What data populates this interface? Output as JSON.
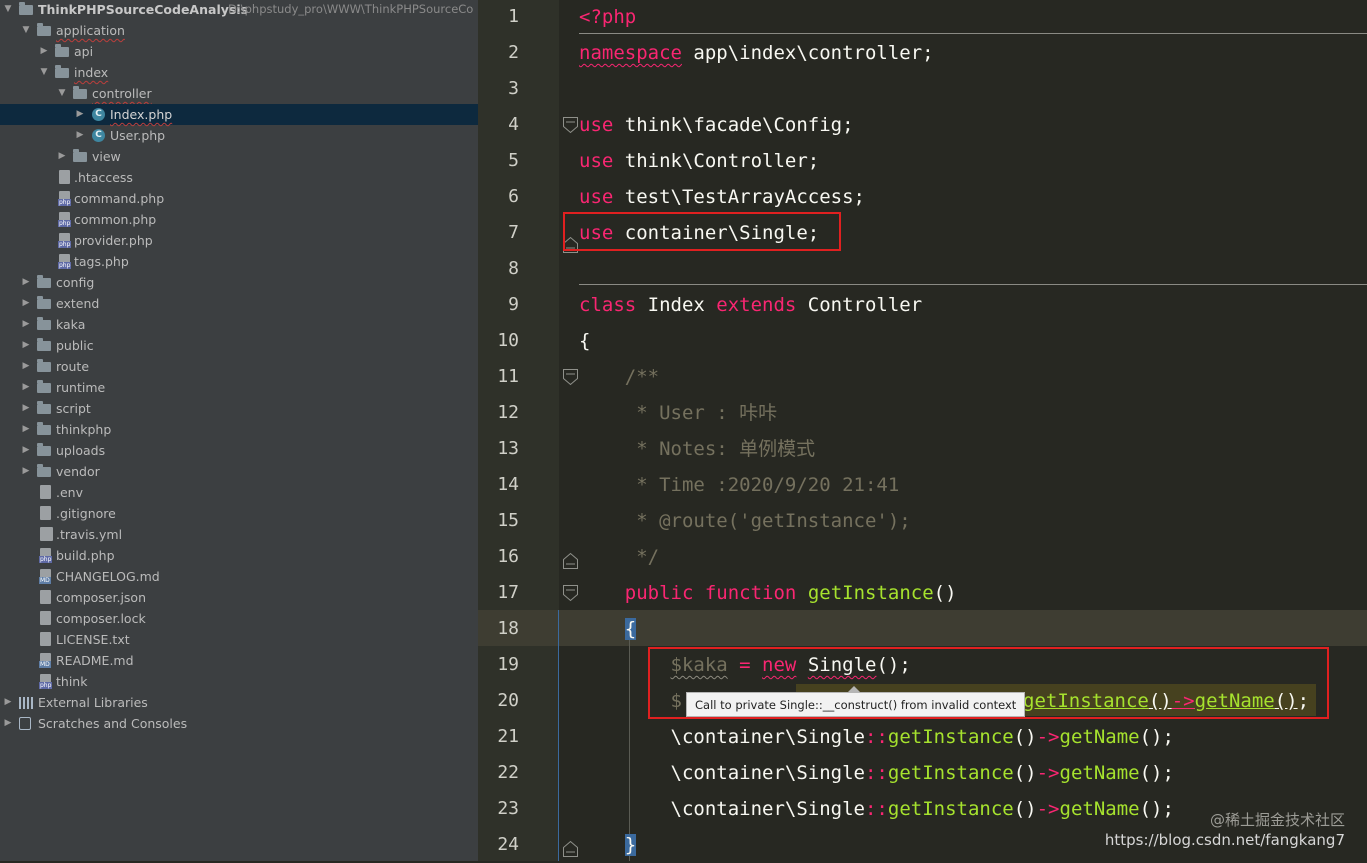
{
  "project_tree": {
    "root": {
      "label": "ThinkPHPSourceCodeAnalysis",
      "path": "D:\\phpstudy_pro\\WWW\\ThinkPHPSourceCo"
    },
    "items": [
      {
        "label": "application",
        "icon": "folder-icon",
        "expanded": true
      },
      {
        "label": "api",
        "icon": "folder-icon",
        "expanded": false
      },
      {
        "label": "index",
        "icon": "folder-icon",
        "expanded": true
      },
      {
        "label": "controller",
        "icon": "folder-icon",
        "expanded": true
      },
      {
        "label": "Index.php",
        "icon": "php-class-icon",
        "selected": true
      },
      {
        "label": "User.php",
        "icon": "php-class-icon"
      },
      {
        "label": "view",
        "icon": "folder-icon",
        "expanded": false
      },
      {
        "label": ".htaccess",
        "icon": "htaccess-file-icon"
      },
      {
        "label": "command.php",
        "icon": "php-file-icon"
      },
      {
        "label": "common.php",
        "icon": "php-file-icon"
      },
      {
        "label": "provider.php",
        "icon": "php-file-icon"
      },
      {
        "label": "tags.php",
        "icon": "php-file-icon"
      },
      {
        "label": "config",
        "icon": "folder-icon",
        "expanded": false
      },
      {
        "label": "extend",
        "icon": "folder-icon",
        "expanded": false
      },
      {
        "label": "kaka",
        "icon": "folder-icon",
        "expanded": false
      },
      {
        "label": "public",
        "icon": "folder-icon",
        "expanded": false
      },
      {
        "label": "route",
        "icon": "folder-icon",
        "expanded": false
      },
      {
        "label": "runtime",
        "icon": "folder-icon",
        "expanded": false
      },
      {
        "label": "script",
        "icon": "folder-icon",
        "expanded": false
      },
      {
        "label": "thinkphp",
        "icon": "folder-icon",
        "expanded": false
      },
      {
        "label": "uploads",
        "icon": "folder-icon",
        "expanded": false
      },
      {
        "label": "vendor",
        "icon": "folder-icon",
        "expanded": false
      },
      {
        "label": ".env",
        "icon": "text-file-icon"
      },
      {
        "label": ".gitignore",
        "icon": "text-file-icon"
      },
      {
        "label": ".travis.yml",
        "icon": "yaml-file-icon"
      },
      {
        "label": "build.php",
        "icon": "php-file-icon"
      },
      {
        "label": "CHANGELOG.md",
        "icon": "markdown-file-icon"
      },
      {
        "label": "composer.json",
        "icon": "json-file-icon"
      },
      {
        "label": "composer.lock",
        "icon": "lock-file-icon"
      },
      {
        "label": "LICENSE.txt",
        "icon": "text-file-icon"
      },
      {
        "label": "README.md",
        "icon": "markdown-file-icon"
      },
      {
        "label": "think",
        "icon": "php-file-icon"
      },
      {
        "label": "External Libraries",
        "icon": "libraries-icon",
        "expanded": false
      },
      {
        "label": "Scratches and Consoles",
        "icon": "scratches-icon",
        "expanded": false
      }
    ]
  },
  "editor": {
    "line_numbers": [
      "1",
      "2",
      "3",
      "4",
      "5",
      "6",
      "7",
      "8",
      "9",
      "10",
      "11",
      "12",
      "13",
      "14",
      "15",
      "16",
      "17",
      "18",
      "19",
      "20",
      "21",
      "22",
      "23",
      "24"
    ],
    "lines": {
      "l1": "<?php",
      "l2_kw": "namespace",
      "l2_rest": " app\\index\\controller;",
      "l4_kw": "use",
      "l4_rest": " think\\facade\\Config;",
      "l5_kw": "use",
      "l5_rest": " think\\Controller;",
      "l6_kw": "use",
      "l6_rest": " test\\TestArrayAccess;",
      "l7_kw": "use",
      "l7_rest": " container\\Single;",
      "l9_kw1": "class",
      "l9_name": " Index ",
      "l9_kw2": "extends",
      "l9_rest": " Controller",
      "l10": "{",
      "l11": "    /**",
      "l12": "     * User : 咔咔",
      "l13": "     * Notes: 单例模式",
      "l14": "     * Time :2020/9/20 21:41",
      "l15": "     * @route('getInstance');",
      "l16": "     */",
      "l17_pre": "    ",
      "l17_kw1": "public",
      "l17_kw2": "function",
      "l17_fn": "getInstance",
      "l17_rest": "()",
      "l18_pre": "    ",
      "l18_brace": "{",
      "l19_pre": "        ",
      "l19_var": "$kaka",
      "l19_eq": " = ",
      "l19_kw": "new",
      "l19_cls": "Single",
      "l19_rest": "();",
      "l20_pre": "        ",
      "l20_var": "$",
      "l20_fn1": "getInstance",
      "l20_p1": "()",
      "l20_op": "->",
      "l20_fn2": "getName",
      "l20_p2": "()",
      "l20_end": ";",
      "l21_pre": "        ",
      "l21_cls": "\\container\\Single",
      "l21_op1": "::",
      "l21_fn1": "getInstance",
      "l21_p1": "()",
      "l21_op2": "->",
      "l21_fn2": "getName",
      "l21_end": "();",
      "l22_pre": "        ",
      "l22_cls": "\\container\\Single",
      "l22_op1": "::",
      "l22_fn1": "getInstance",
      "l22_p1": "()",
      "l22_op2": "->",
      "l22_fn2": "getName",
      "l22_end": "();",
      "l23_pre": "        ",
      "l23_cls": "\\container\\Single",
      "l23_op1": "::",
      "l23_fn1": "getInstance",
      "l23_p1": "()",
      "l23_op2": "->",
      "l23_fn2": "getName",
      "l23_end": "();",
      "l24_pre": "    ",
      "l24_brace": "}"
    },
    "tooltip": "Call to private Single::__construct() from invalid context"
  },
  "watermark": {
    "line1": "@稀土掘金技术社区",
    "line2": "https://blog.csdn.net/fangkang7"
  },
  "colors": {
    "keyword": "#f92672",
    "function": "#a6e22e",
    "comment": "#75715e",
    "annotation_box": "#e02020"
  }
}
